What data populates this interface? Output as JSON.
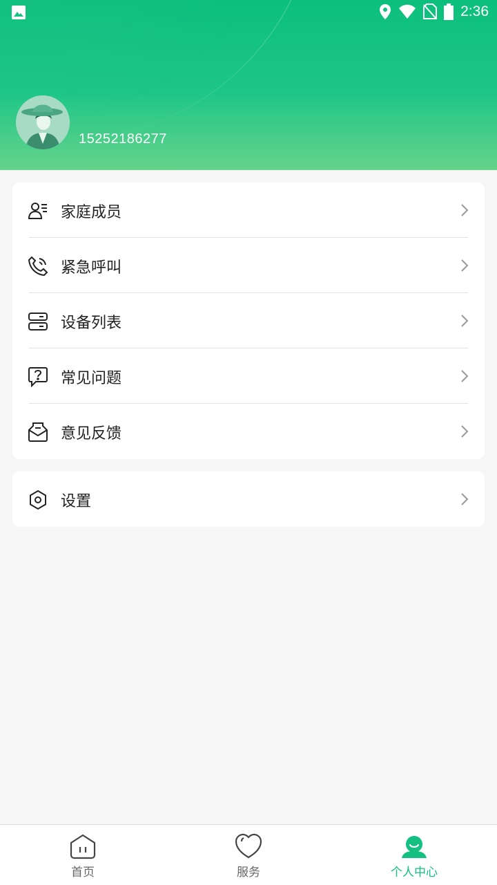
{
  "status_bar": {
    "time": "2:36"
  },
  "profile": {
    "phone": "15252186277"
  },
  "menu": {
    "items": [
      {
        "label": "家庭成员",
        "icon": "family-member-icon"
      },
      {
        "label": "紧急呼叫",
        "icon": "phone-call-icon"
      },
      {
        "label": "设备列表",
        "icon": "device-list-icon"
      },
      {
        "label": "常见问题",
        "icon": "faq-icon"
      },
      {
        "label": "意见反馈",
        "icon": "feedback-icon"
      }
    ],
    "settings": {
      "label": "设置",
      "icon": "settings-icon"
    }
  },
  "tabbar": {
    "tabs": [
      {
        "label": "首页",
        "icon": "home-icon"
      },
      {
        "label": "服务",
        "icon": "heart-icon"
      },
      {
        "label": "个人中心",
        "icon": "profile-icon",
        "active": true
      }
    ]
  },
  "colors": {
    "accent": "#13c081",
    "header_top": "#0cbf7c",
    "header_bottom": "#66d38b"
  }
}
